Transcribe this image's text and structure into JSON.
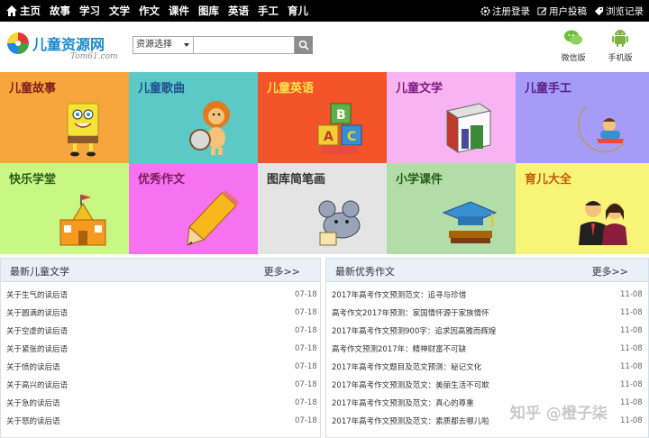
{
  "topnav": {
    "links": [
      "主页",
      "故事",
      "学习",
      "文学",
      "作文",
      "课件",
      "图库",
      "英语",
      "手工",
      "育儿"
    ],
    "right": [
      "注册登录",
      "用户投稿",
      "浏览记录"
    ]
  },
  "header": {
    "logo_title": "儿童资源网",
    "logo_sub": "Tom61.com",
    "search_select": "资源选择",
    "search_placeholder": "",
    "apps": [
      "微信版",
      "手机版"
    ]
  },
  "tiles": [
    {
      "label": "儿童故事",
      "bg": "#f7a63d",
      "color": "#7a1d1d",
      "icon": "sponge-cartoon-icon"
    },
    {
      "label": "儿童歌曲",
      "bg": "#5cc9c6",
      "color": "#1d4f8c",
      "icon": "lion-drum-icon"
    },
    {
      "label": "儿童英语",
      "bg": "#f3542a",
      "color": "#ffe44a",
      "icon": "alphabet-blocks-icon"
    },
    {
      "label": "儿童文学",
      "bg": "#f7b4f0",
      "color": "#7a1d82",
      "icon": "books-icon"
    },
    {
      "label": "儿童手工",
      "bg": "#a49cf7",
      "color": "#5a1d82",
      "icon": "moon-child-icon"
    },
    {
      "label": "快乐学堂",
      "bg": "#c8f784",
      "color": "#2a5a1a",
      "icon": "school-icon"
    },
    {
      "label": "优秀作文",
      "bg": "#f772f0",
      "color": "#7a1d5a",
      "icon": "pencil-icon"
    },
    {
      "label": "图库简笔画",
      "bg": "#e4e4e4",
      "color": "#333333",
      "icon": "mouse-drawing-icon"
    },
    {
      "label": "小学课件",
      "bg": "#b3dda7",
      "color": "#2a5a1a",
      "icon": "grad-cap-icon"
    },
    {
      "label": "育儿大全",
      "bg": "#f8f478",
      "color": "#c25a0a",
      "icon": "parents-icon"
    }
  ],
  "lit_panel": {
    "title": "最新儿童文学",
    "more": "更多>>",
    "items": [
      {
        "text": "关于生气的读后语",
        "date": "07-18"
      },
      {
        "text": "关于圆满的读后语",
        "date": "07-18"
      },
      {
        "text": "关于空虚的读后语",
        "date": "07-18"
      },
      {
        "text": "关于紧张的读后语",
        "date": "07-18"
      },
      {
        "text": "关于愤的读后语",
        "date": "07-18"
      },
      {
        "text": "关于高兴的读后语",
        "date": "07-18"
      },
      {
        "text": "关于急的读后语",
        "date": "07-18"
      },
      {
        "text": "关于怒的读后语",
        "date": "07-18"
      }
    ]
  },
  "essay_panel": {
    "title": "最新优秀作文",
    "more": "更多>>",
    "items": [
      {
        "text": "2017年高考作文预测范文：追寻与珍惜",
        "date": "11-08"
      },
      {
        "text": "高考作文2017年预测：家国情怀源于家族情怀",
        "date": "11-08"
      },
      {
        "text": "2017年高考作文预测900字：追求因高雅而辉煌",
        "date": "11-08"
      },
      {
        "text": "高考作文预测2017年：精神财富不可缺",
        "date": "11-08"
      },
      {
        "text": "2017年高考作文题目及范文预测：秘记文化",
        "date": "11-08"
      },
      {
        "text": "2017年高考作文预测及范文：美丽生活不可欺",
        "date": "11-08"
      },
      {
        "text": "2017年高考作文预测及范文：真心的尊重",
        "date": "11-08"
      },
      {
        "text": "2017年高考作文预测及范文：素质都去哪儿啦",
        "date": "11-08"
      }
    ]
  },
  "watermark": "知乎 @橙子柒"
}
